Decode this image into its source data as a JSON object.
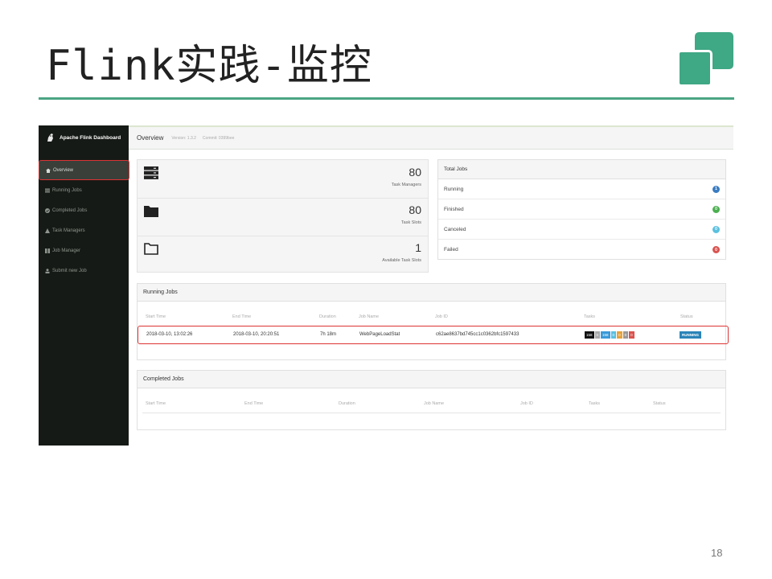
{
  "slide": {
    "title": "Flink实践-监控",
    "page_number": "18"
  },
  "colors": {
    "accent": "#3fa884",
    "sidebar": "#161a16",
    "highlight": "#dd3333"
  },
  "sidebar": {
    "brand": "Apache Flink Dashboard",
    "items": [
      {
        "label": "Overview",
        "icon": "home-icon"
      },
      {
        "label": "Running Jobs",
        "icon": "list-icon"
      },
      {
        "label": "Completed Jobs",
        "icon": "check-circle-icon"
      },
      {
        "label": "Task Managers",
        "icon": "sitemap-icon"
      },
      {
        "label": "Job Manager",
        "icon": "tasks-icon"
      },
      {
        "label": "Submit new Job",
        "icon": "upload-icon"
      }
    ]
  },
  "topbar": {
    "title": "Overview",
    "version": "Version: 1.3.2",
    "commit": "Commit: 0399bee"
  },
  "stats": [
    {
      "value": "80",
      "label": "Task Managers",
      "icon": "server-icon"
    },
    {
      "value": "80",
      "label": "Task Slots",
      "icon": "folder-filled-icon"
    },
    {
      "value": "1",
      "label": "Available Task Slots",
      "icon": "folder-open-icon"
    }
  ],
  "total_jobs": {
    "title": "Total Jobs",
    "rows": [
      {
        "label": "Running",
        "count": "1",
        "color": "#3a7cc2"
      },
      {
        "label": "Finished",
        "count": "0",
        "color": "#4caf50"
      },
      {
        "label": "Canceled",
        "count": "0",
        "color": "#5bc0de"
      },
      {
        "label": "Failed",
        "count": "0",
        "color": "#d9534f"
      }
    ]
  },
  "running_jobs": {
    "title": "Running Jobs",
    "columns": [
      "Start Time",
      "End Time",
      "Duration",
      "Job Name",
      "Job ID",
      "Tasks",
      "Status"
    ],
    "rows": [
      {
        "start_time": "2018-03-10, 13:02:26",
        "end_time": "2018-03-10, 20:20:51",
        "duration": "7h 18m",
        "job_name": "WebPageLoadStat",
        "job_id": "c62ae8637bd745cc1c0362bfc1597433",
        "tasks": [
          {
            "value": "158",
            "color": "#111111"
          },
          {
            "value": "0",
            "color": "#aaaaaa"
          },
          {
            "value": "158",
            "color": "#3a9ad9"
          },
          {
            "value": "0",
            "color": "#5bc0de"
          },
          {
            "value": "0",
            "color": "#e6a23c"
          },
          {
            "value": "0",
            "color": "#999999"
          },
          {
            "value": "0",
            "color": "#d9534f"
          }
        ],
        "status": "RUNNING"
      }
    ]
  },
  "completed_jobs": {
    "title": "Completed Jobs",
    "columns": [
      "Start Time",
      "End Time",
      "Duration",
      "Job Name",
      "Job ID",
      "Tasks",
      "Status"
    ]
  }
}
